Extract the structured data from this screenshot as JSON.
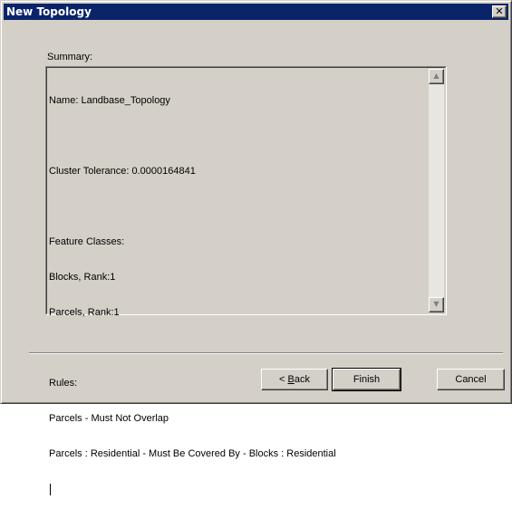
{
  "window": {
    "title": "New Topology",
    "close_glyph": "✕"
  },
  "summary": {
    "label": "Summary:",
    "lines": {
      "name": "Name: Landbase_Topology",
      "tolerance": "Cluster Tolerance: 0.0000164841",
      "feature_classes_header": "Feature Classes:",
      "fc1": "Blocks, Rank:1",
      "fc2": "Parcels, Rank:1",
      "rules_header": "Rules:",
      "rule1": "Parcels - Must Not Overlap",
      "rule2": "Parcels : Residential - Must Be Covered By - Blocks : Residential"
    },
    "scroll_up_icon": "triangle-up-icon",
    "scroll_down_icon": "triangle-down-icon"
  },
  "buttons": {
    "back_prefix": "< ",
    "back_underlined": "B",
    "back_rest": "ack",
    "finish": "Finish",
    "cancel": "Cancel"
  },
  "colors": {
    "titlebar": "#0a246a",
    "face": "#d4d0c8"
  }
}
